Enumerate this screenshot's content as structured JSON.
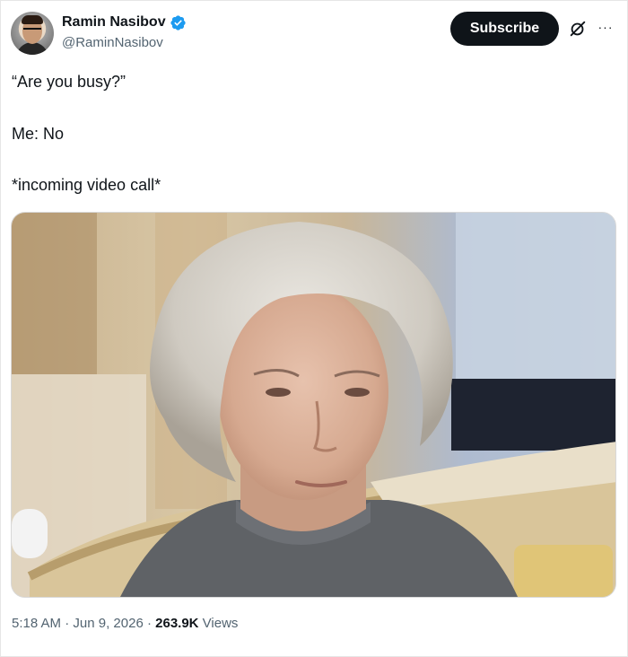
{
  "author": {
    "display_name": "Ramin Nasibov",
    "handle": "@RaminNasibov",
    "verified": true
  },
  "actions": {
    "subscribe_label": "Subscribe",
    "more_label": "···"
  },
  "tweet": {
    "lines": [
      "“Are you busy?”",
      "Me: No",
      "*incoming video call*"
    ]
  },
  "meta": {
    "time": "5:18 AM",
    "separator": " · ",
    "date": "Jun 9, 2026",
    "views_count": "263.9K",
    "views_label": " Views"
  },
  "colors": {
    "verified_blue": "#1d9bf0",
    "subscribe_bg": "#0f1419",
    "secondary_text": "#536471"
  }
}
